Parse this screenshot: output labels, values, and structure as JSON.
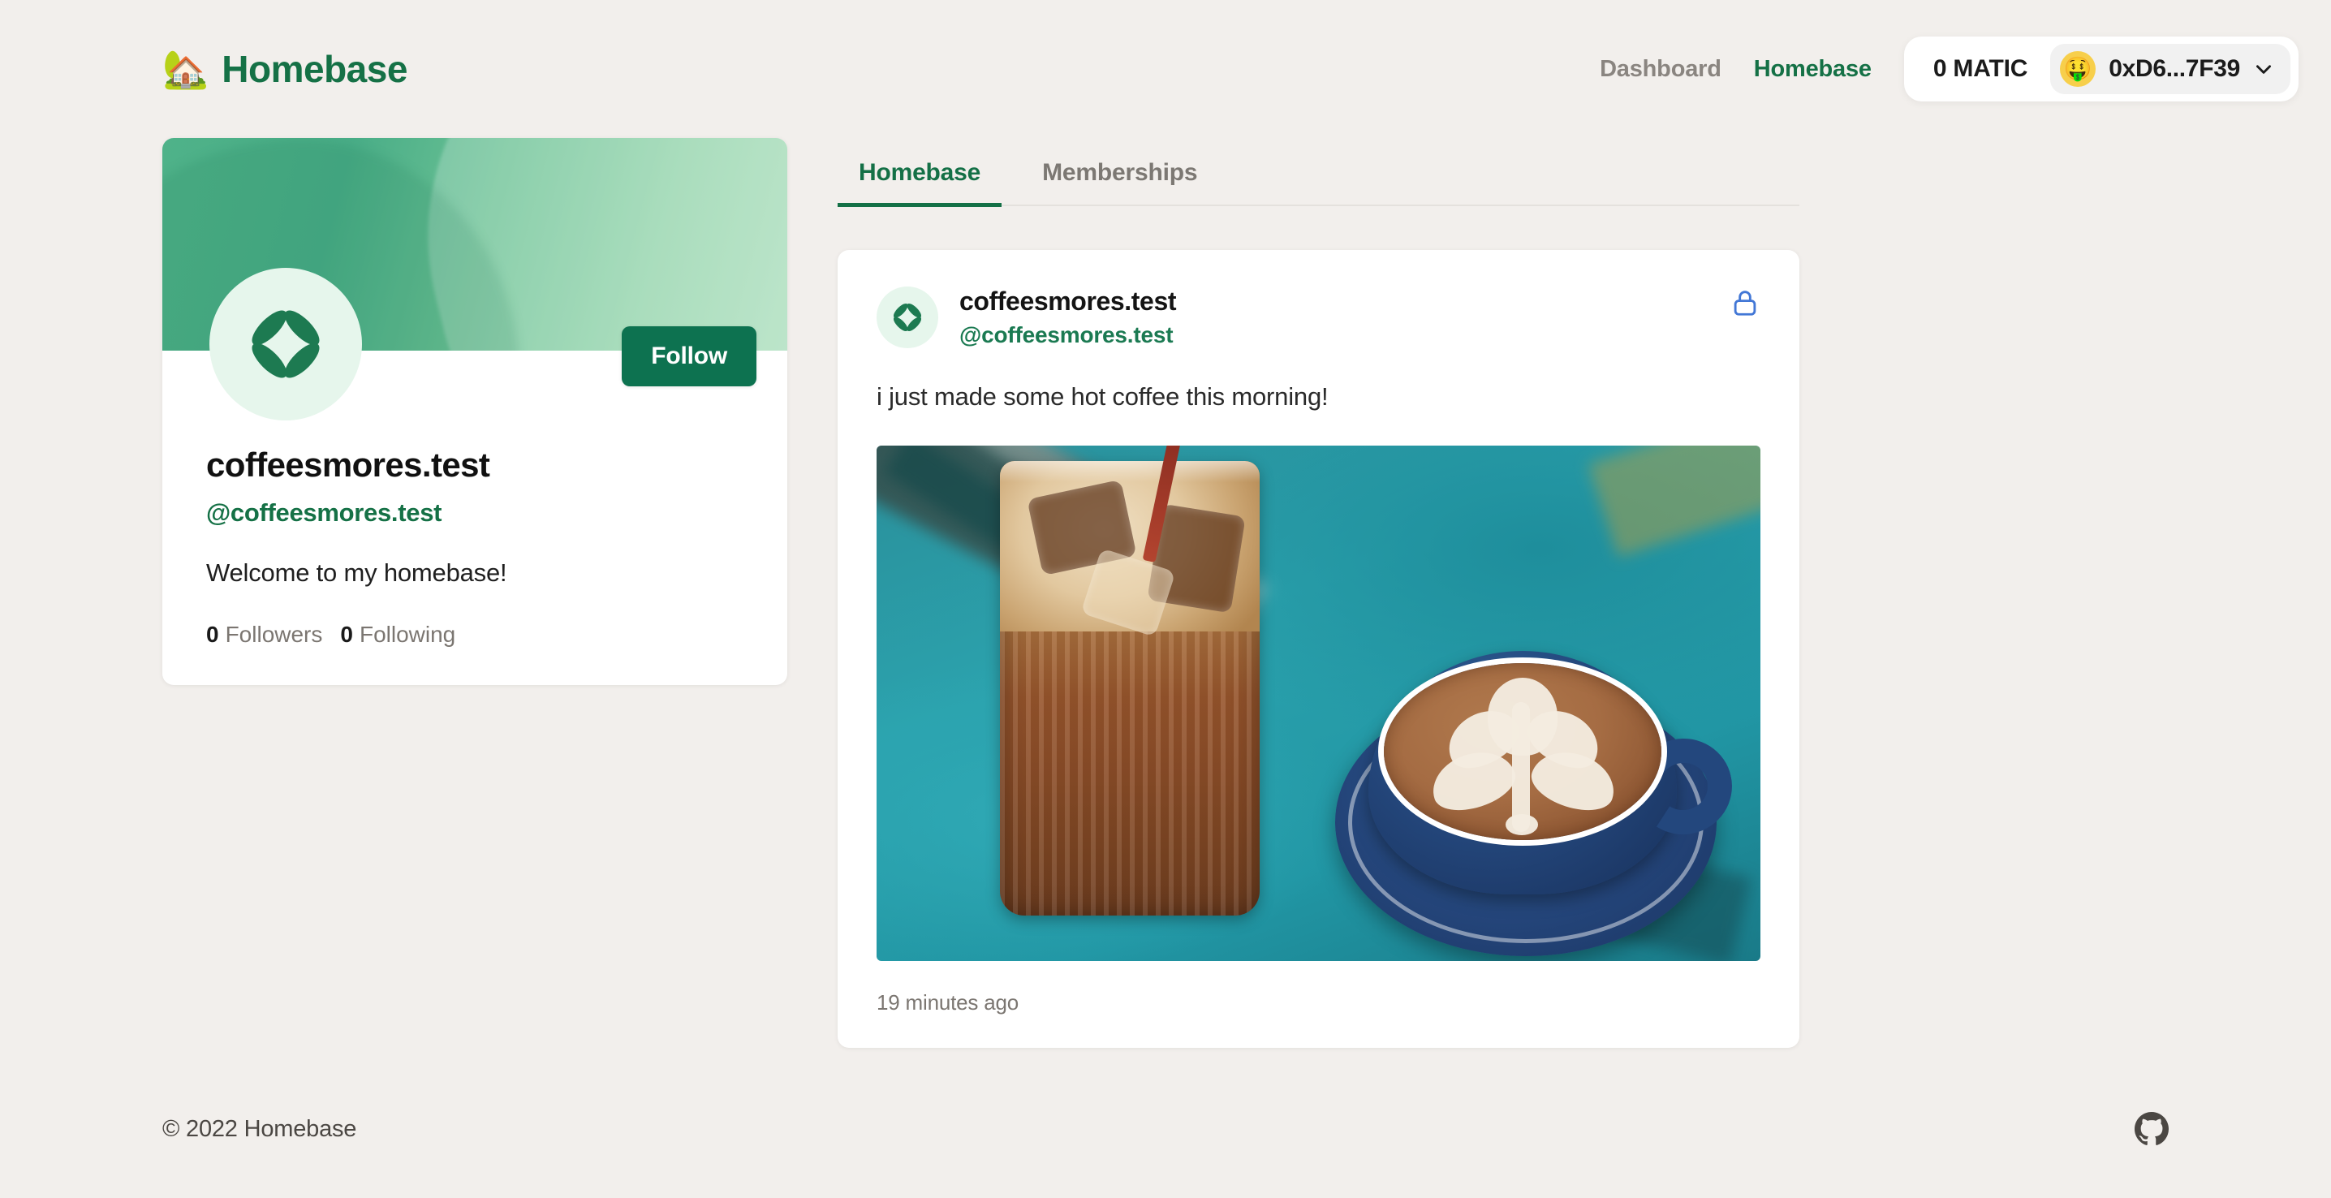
{
  "header": {
    "logo_emoji": "🏡",
    "logo_icon": "house-with-garden-icon",
    "brand": "Homebase",
    "nav": [
      {
        "label": "Dashboard",
        "active": false
      },
      {
        "label": "Homebase",
        "active": true
      }
    ],
    "wallet": {
      "balance": "0 MATIC",
      "avatar_emoji": "🤑",
      "avatar_icon": "money-mouth-face-icon",
      "address": "0xD6...7F39",
      "chevron_icon": "chevron-down-icon"
    }
  },
  "profile": {
    "name": "coffeesmores.test",
    "handle": "@coffeesmores.test",
    "bio": "Welcome to my homebase!",
    "follow_label": "Follow",
    "avatar_icon": "four-petal-flower-icon",
    "stats": [
      {
        "count": "0",
        "label": "Followers"
      },
      {
        "count": "0",
        "label": "Following"
      }
    ]
  },
  "feed": {
    "tabs": [
      {
        "label": "Homebase",
        "active": true
      },
      {
        "label": "Memberships",
        "active": false
      }
    ],
    "posts": [
      {
        "author": "coffeesmores.test",
        "handle": "@coffeesmores.test",
        "avatar_icon": "four-petal-flower-icon",
        "privacy_icon": "lock-icon",
        "text": "i just made some hot coffee this morning!",
        "image_alt": "iced coffee glass and blue latte cup with rosetta art on a teal table",
        "timestamp": "19 minutes ago"
      }
    ]
  },
  "footer": {
    "copyright": "© 2022 Homebase",
    "github_icon": "github-icon"
  },
  "colors": {
    "page_bg": "#f2efec",
    "brand_green": "#157146",
    "accent_green": "#0d7250",
    "banner_from": "#4fb289",
    "banner_to": "#a9ddbb",
    "muted_text": "#7c7873",
    "lock_blue": "#4277d6",
    "wallet_avatar": "#f7cf4b"
  }
}
